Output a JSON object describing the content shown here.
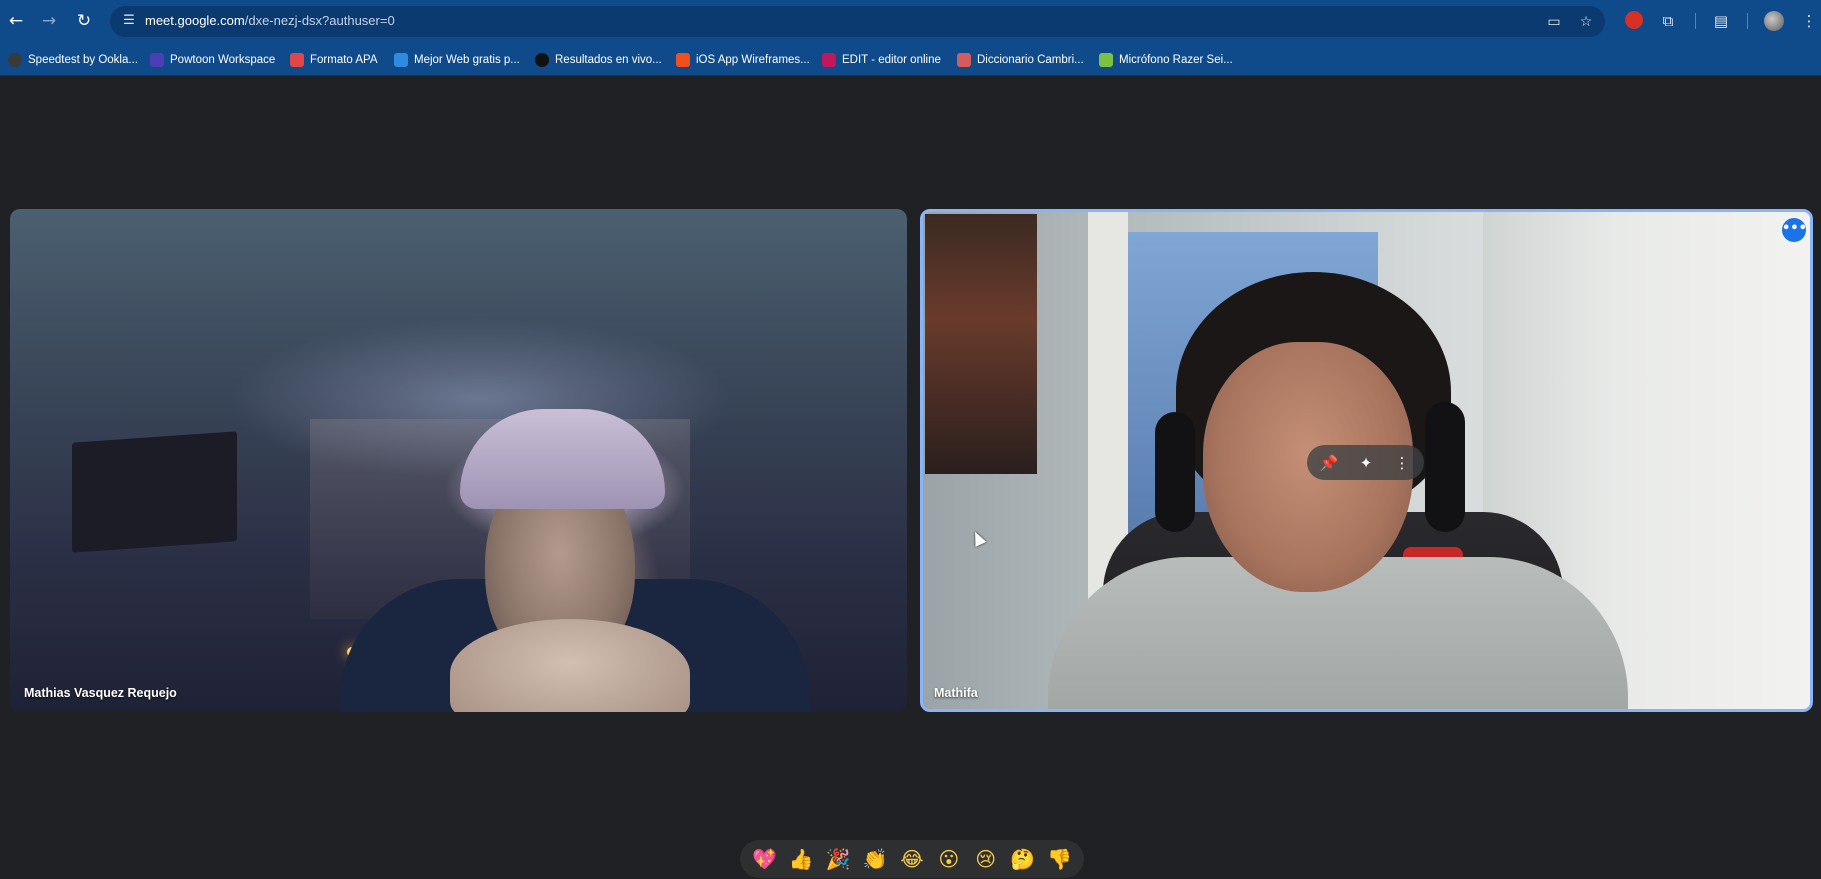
{
  "browser": {
    "url_host": "meet.google.com",
    "url_path": "/dxe-nezj-dsx?authuser=0",
    "icons": {
      "back": "arrow-left-icon",
      "forward": "arrow-right-icon",
      "reload": "reload-icon",
      "site_info": "tune-icon",
      "camera": "camera-icon",
      "bookmark": "star-icon",
      "extensions": "puzzle-icon",
      "side_panel": "side-panel-icon",
      "menu": "kebab-icon"
    }
  },
  "bookmarks": [
    {
      "label": "Speedtest by Ookla...",
      "color": "#3a3a3a"
    },
    {
      "label": "Powtoon Workspace",
      "color": "#4a3fb5"
    },
    {
      "label": "Formato APA",
      "color": "#e04848"
    },
    {
      "label": "Mejor Web gratis p...",
      "color": "#2f8ae0"
    },
    {
      "label": "Resultados en vivo...",
      "color": "#111111"
    },
    {
      "label": "iOS App Wireframes...",
      "color": "#f24e1e"
    },
    {
      "label": "EDIT - editor online",
      "color": "#c2185b"
    },
    {
      "label": "Diccionario Cambri...",
      "color": "#d45c5c"
    },
    {
      "label": "Micrófono Razer Sei...",
      "color": "#7cc242"
    }
  ],
  "meet": {
    "participants": [
      {
        "name": "Mathias Vasquez Requejo"
      },
      {
        "name": "Mathifa"
      }
    ],
    "active_speaker_border": "#8ab4f8",
    "tile_controls": {
      "pin": "pin-icon",
      "effects": "sparkle-icon",
      "more": "kebab-icon"
    },
    "more_options_icon": "more-horiz-icon"
  },
  "reactions": [
    "💖",
    "👍",
    "🎉",
    "👏",
    "😂",
    "😮",
    "😢",
    "🤔",
    "👎"
  ]
}
